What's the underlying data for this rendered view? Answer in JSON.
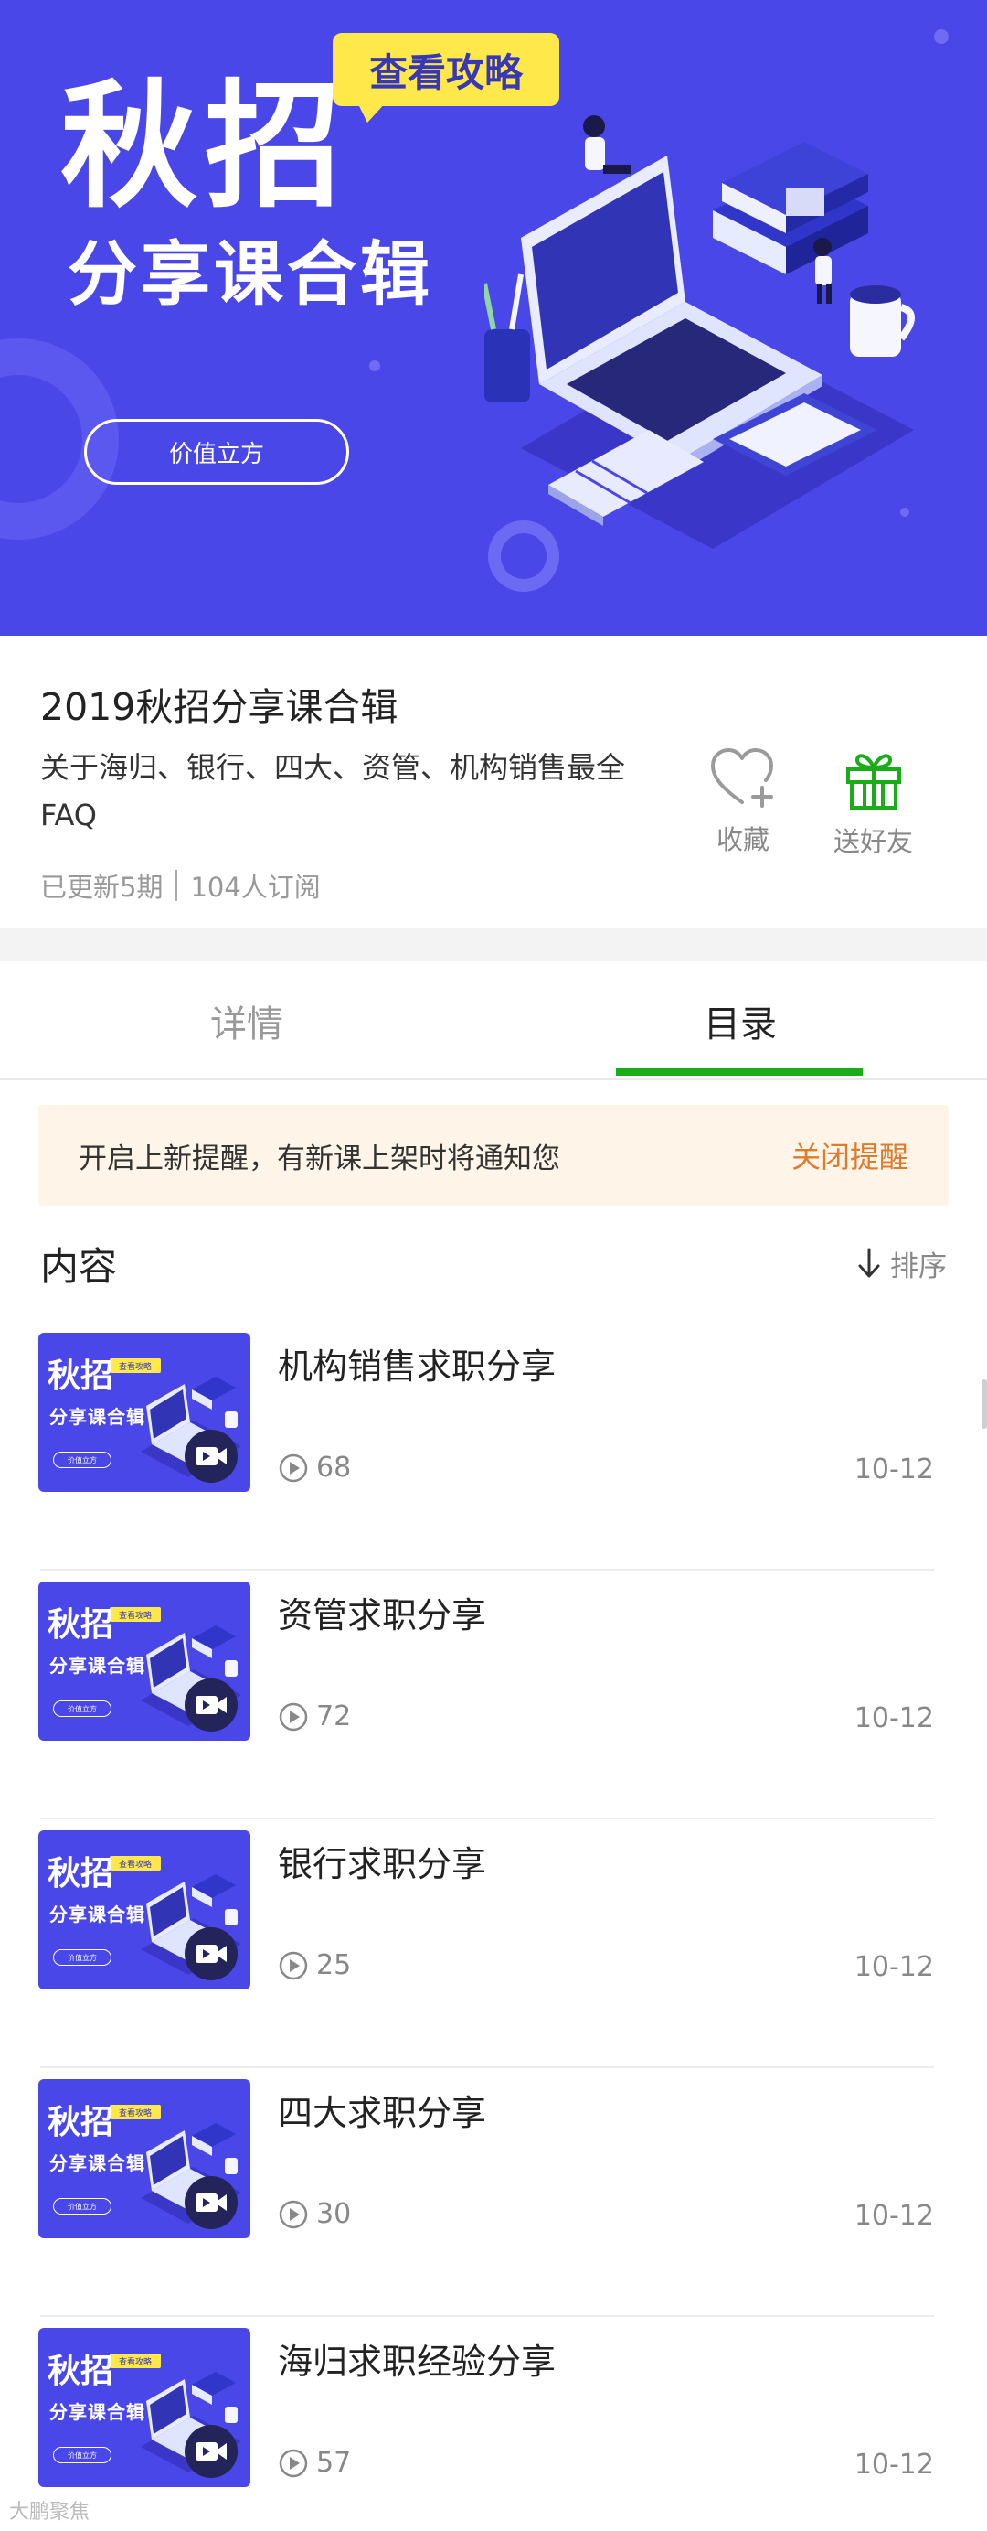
{
  "banner": {
    "title": "秋招",
    "subtitle": "分享课合辑",
    "badge": "查看攻略",
    "button": "价值立方"
  },
  "course": {
    "title": "2019秋招分享课合辑",
    "description": "关于海归、银行、四大、资管、机构销售最全FAQ",
    "updated": "已更新5期",
    "subscribers": "104人订阅"
  },
  "actions": {
    "favorite_label": "收藏",
    "gift_label": "送好友"
  },
  "tabs": [
    {
      "label": "详情",
      "active": false
    },
    {
      "label": "目录",
      "active": true
    }
  ],
  "notice": {
    "text": "开启上新提醒，有新课上架时将通知您",
    "action": "关闭提醒"
  },
  "content": {
    "title": "内容",
    "sort_label": "排序"
  },
  "thumbnail": {
    "title": "秋招",
    "subtitle": "分享课合辑",
    "badge": "查看攻略",
    "button": "价值立方"
  },
  "items": [
    {
      "title": "机构销售求职分享",
      "plays": "68",
      "date": "10-12"
    },
    {
      "title": "资管求职分享",
      "plays": "72",
      "date": "10-12"
    },
    {
      "title": "银行求职分享",
      "plays": "25",
      "date": "10-12"
    },
    {
      "title": "四大求职分享",
      "plays": "30",
      "date": "10-12"
    },
    {
      "title": "海归求职经验分享",
      "plays": "57",
      "date": "10-12"
    }
  ],
  "watermark": "大鹏聚焦",
  "colors": {
    "banner": "#4a47e8",
    "accent_green": "#1aad19",
    "notice_bg": "#fef4e8",
    "notice_action": "#e07b2d",
    "badge_yellow": "#ffe94a"
  },
  "icons": {
    "favorite": "heart-plus-icon",
    "gift": "gift-icon",
    "sort": "arrow-down-icon",
    "plays": "play-circle-icon",
    "video": "video-camera-icon"
  }
}
